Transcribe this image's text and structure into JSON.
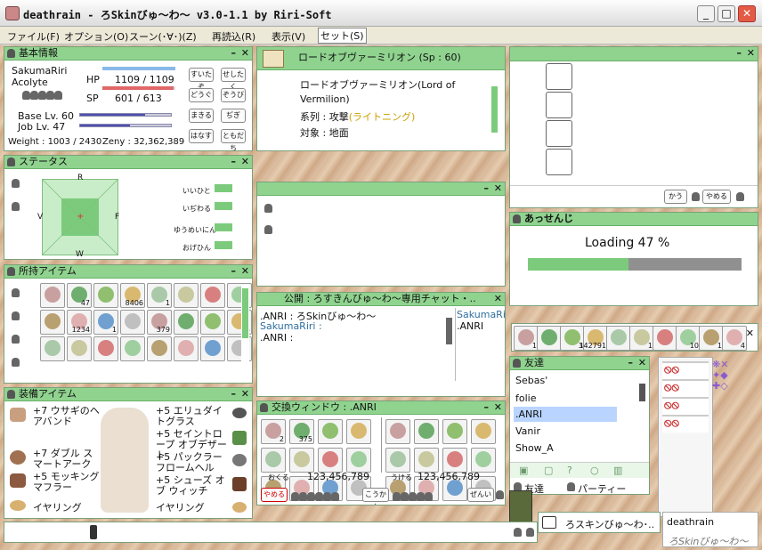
{
  "app": {
    "title": "deathrain - ろSkinびゅ～わ～ v3.0-1.1 by Riri-Soft",
    "minimize": "_",
    "maximize": "□",
    "close": "✕"
  },
  "menu": [
    "ファイル(F)",
    "オプション(O)",
    "スーン(･∀･)(Z)",
    "再読込(R)",
    "表示(V)",
    "セット(S)"
  ],
  "basic": {
    "title": "基本情報",
    "name": "SakumaRiri",
    "job": "Acolyte",
    "hp_label": "HP",
    "hp_value": "1109 / 1109",
    "sp_label": "SP",
    "sp_value": "601 / 613",
    "hp_fraction": 1.0,
    "sp_fraction": 0.98,
    "base_label": "Base Lv. 60",
    "job_label": "Job Lv. 47",
    "base_fraction": 0.72,
    "job_fraction": 0.55,
    "weight": "Weight : 1003 / 2430",
    "zeny": "Zeny : 32,362,389",
    "buttons": [
      "すいたぞ",
      "せしたく",
      "どうぐ",
      "ぞうび",
      "まきる",
      "ぢぎ",
      "はなす",
      "ともだち"
    ]
  },
  "skill": {
    "name": "ロードオブヴァーミリオン (Sp : 60)",
    "desc1": "ロードオブヴァーミリオン(Lord of",
    "desc2": "Vermilion)",
    "type_label": "系列 : 攻撃",
    "type_value": "(ライトニング)",
    "target": "対象 : 地面"
  },
  "status": {
    "title": "ステータス",
    "labels": [
      "R",
      "V",
      "F",
      "W"
    ],
    "params": [
      "いいひと",
      "いぢわる",
      "ゆうめいにん",
      "おげひん"
    ]
  },
  "inventory": {
    "title": "所持アイテム",
    "counts": [
      "",
      "47",
      "",
      "8406",
      "1",
      "",
      "",
      "",
      "",
      "1234",
      "1",
      "",
      "379",
      "",
      "",
      "15",
      "",
      "",
      "",
      "",
      "",
      "",
      "",
      ""
    ]
  },
  "equip": {
    "title": "装備アイテム",
    "left": [
      "+7 ウサギのヘアバンド",
      "+7 ダブル スマートアーク",
      "+5 モッキングマフラー",
      "イヤリング"
    ],
    "right": [
      "+5 エリュダイトグラス",
      "+5 セイントロープ オブデザート",
      "+5 パックラー フロームヘル",
      "+5 シューズ オブ ウィッチ",
      "イヤリング"
    ]
  },
  "chat": {
    "title": "公開 : ろすきんびゅ～わ～専用チャット・..",
    "lines": [
      ".ANRI : ろSkinびゅ～わ～",
      "SakumaRiri :",
      ".ANRI :"
    ],
    "members": [
      "SakumaRiri",
      ".ANRI"
    ]
  },
  "trade": {
    "title": "交換ウィンドウ : .ANRI",
    "my_zeny": "123,456,789",
    "their_zeny": "123,456,789",
    "my_label": "おくる",
    "their_label": "うける",
    "counts_left": [
      "2",
      "375",
      "",
      "",
      "",
      "",
      "",
      "",
      "",
      "",
      "",
      "1"
    ],
    "counts_right": [
      "",
      "",
      "",
      "",
      "",
      "",
      "",
      "",
      "",
      "",
      "",
      "4"
    ],
    "cancel": "やめる",
    "exchange": "こうかん",
    "ok": "ぜんい"
  },
  "cart": {
    "yes": "かう",
    "no": "やめる"
  },
  "loading": {
    "title": "あっせんじ",
    "text": "Loading 47 %",
    "fraction": 0.47
  },
  "hotbar": {
    "counts": [
      "1",
      "",
      "3",
      "142791",
      "",
      "1",
      "",
      "10",
      "1",
      "4"
    ]
  },
  "friends": {
    "title": "友達",
    "items": [
      "Sebas'",
      "folie",
      ".ANRI",
      "Vanir",
      "Show_A"
    ],
    "selected": 2,
    "tab_friends": "友達",
    "tab_party": "パーティー"
  },
  "bottom": {
    "chat_tab": "ろスキンびゅ～わ･..",
    "player": "deathrain",
    "brand": "ろSkinびゅ～わ～"
  }
}
